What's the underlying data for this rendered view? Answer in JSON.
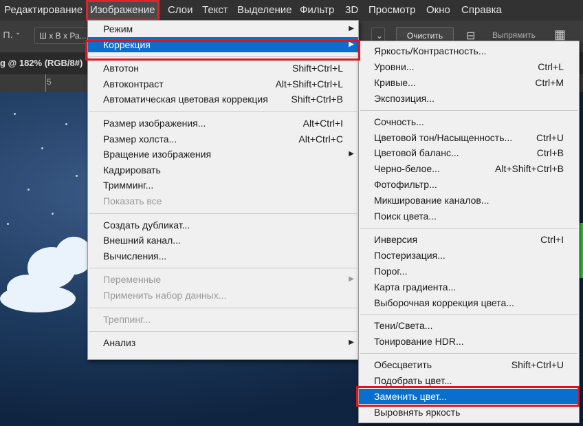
{
  "menubar": {
    "items": [
      "Редактирование",
      "Изображение",
      "Слои",
      "Текст",
      "Выделение",
      "Фильтр",
      "3D",
      "Просмотр",
      "Окно",
      "Справка"
    ]
  },
  "options_bar": {
    "tool_glyph": "⊓.",
    "ratio_select": "Ш x В x Ра...",
    "clear_button": "Очистить",
    "straighten_label": "Выпрямить"
  },
  "document": {
    "tab_title": "g @ 182% (RGB/8#)",
    "ruler_tick": "5"
  },
  "image_menu": {
    "items": [
      {
        "label": "Режим",
        "submenu": true
      },
      {
        "label": "Коррекция",
        "submenu": true,
        "highlighted": true
      },
      {
        "sep": true
      },
      {
        "label": "Автотон",
        "shortcut": "Shift+Ctrl+L"
      },
      {
        "label": "Автоконтраст",
        "shortcut": "Alt+Shift+Ctrl+L"
      },
      {
        "label": "Автоматическая цветовая коррекция",
        "shortcut": "Shift+Ctrl+B"
      },
      {
        "sep": true
      },
      {
        "label": "Размер изображения...",
        "shortcut": "Alt+Ctrl+I"
      },
      {
        "label": "Размер холста...",
        "shortcut": "Alt+Ctrl+C"
      },
      {
        "label": "Вращение изображения",
        "submenu": true
      },
      {
        "label": "Кадрировать"
      },
      {
        "label": "Тримминг..."
      },
      {
        "label": "Показать все",
        "disabled": true
      },
      {
        "sep": true
      },
      {
        "label": "Создать дубликат..."
      },
      {
        "label": "Внешний канал..."
      },
      {
        "label": "Вычисления..."
      },
      {
        "sep": true
      },
      {
        "label": "Переменные",
        "submenu": true,
        "disabled": true
      },
      {
        "label": "Применить набор данных...",
        "disabled": true
      },
      {
        "sep": true
      },
      {
        "label": "Треппинг...",
        "disabled": true
      },
      {
        "sep": true
      },
      {
        "label": "Анализ",
        "submenu": true
      }
    ]
  },
  "correction_menu": {
    "items": [
      {
        "label": "Яркость/Контрастность..."
      },
      {
        "label": "Уровни...",
        "shortcut": "Ctrl+L"
      },
      {
        "label": "Кривые...",
        "shortcut": "Ctrl+M"
      },
      {
        "label": "Экспозиция..."
      },
      {
        "sep": true
      },
      {
        "label": "Сочность..."
      },
      {
        "label": "Цветовой тон/Насыщенность...",
        "shortcut": "Ctrl+U"
      },
      {
        "label": "Цветовой баланс...",
        "shortcut": "Ctrl+B"
      },
      {
        "label": "Черно-белое...",
        "shortcut": "Alt+Shift+Ctrl+B"
      },
      {
        "label": "Фотофильтр..."
      },
      {
        "label": "Микширование каналов..."
      },
      {
        "label": "Поиск цвета..."
      },
      {
        "sep": true
      },
      {
        "label": "Инверсия",
        "shortcut": "Ctrl+I"
      },
      {
        "label": "Постеризация..."
      },
      {
        "label": "Порог..."
      },
      {
        "label": "Карта градиента..."
      },
      {
        "label": "Выборочная коррекция цвета..."
      },
      {
        "sep": true
      },
      {
        "label": "Тени/Света..."
      },
      {
        "label": "Тонирование HDR..."
      },
      {
        "sep": true
      },
      {
        "label": "Обесцветить",
        "shortcut": "Shift+Ctrl+U"
      },
      {
        "label": "Подобрать цвет..."
      },
      {
        "label": "Заменить цвет...",
        "highlighted": true
      },
      {
        "label": "Выровнять яркость"
      }
    ]
  },
  "colors": {
    "highlight": "#0a6ecf",
    "annotation_red": "#e0141d"
  }
}
